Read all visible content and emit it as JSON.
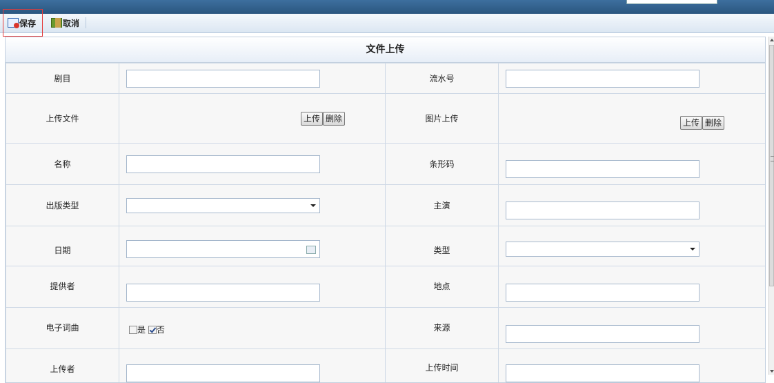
{
  "toolbar": {
    "save_label": "保存",
    "cancel_label": "取消"
  },
  "panel": {
    "title": "文件上传"
  },
  "form": {
    "drama": {
      "label": "剧目",
      "value": ""
    },
    "serial": {
      "label": "流水号",
      "value": ""
    },
    "upload_file": {
      "label": "上传文件",
      "upload_btn": "上传",
      "delete_btn": "删除"
    },
    "image_upload": {
      "label": "图片上传",
      "upload_btn": "上传",
      "delete_btn": "删除"
    },
    "name": {
      "label": "名称",
      "value": ""
    },
    "barcode": {
      "label": "条形码",
      "value": ""
    },
    "publish_type": {
      "label": "出版类型",
      "value": ""
    },
    "lead": {
      "label": "主演",
      "value": ""
    },
    "date": {
      "label": "日期",
      "value": ""
    },
    "type": {
      "label": "类型",
      "value": ""
    },
    "provider": {
      "label": "提供者",
      "value": ""
    },
    "location": {
      "label": "地点",
      "value": ""
    },
    "ktv": {
      "label": "电子词曲",
      "yes": "是",
      "no": "否",
      "yes_checked": false,
      "no_checked": true
    },
    "source": {
      "label": "来源",
      "value": ""
    },
    "uploader": {
      "label": "上传者"
    },
    "upload_time": {
      "label": "上传时间"
    }
  }
}
